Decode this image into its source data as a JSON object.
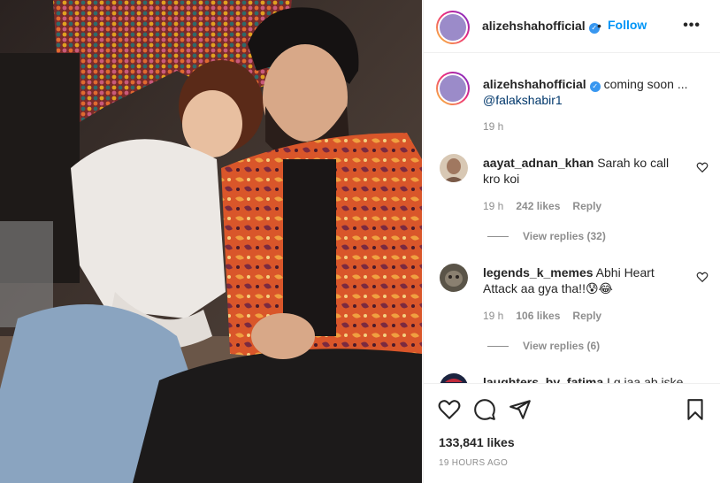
{
  "post": {
    "username": "alizehshahofficial",
    "follow_label": "Follow",
    "separator": "•",
    "more_label": "•••",
    "verified_mark": "✓",
    "caption": {
      "username": "alizehshahofficial",
      "text": "coming soon ...",
      "mention": "@falakshabir1",
      "time": "19 h"
    },
    "comments": [
      {
        "username": "aayat_adnan_khan",
        "text": "Sarah ko call kro koi",
        "time": "19 h",
        "likes": "242 likes",
        "reply_label": "Reply",
        "view_replies": "View replies (32)"
      },
      {
        "username": "legends_k_memes",
        "text": "Abhi Heart Attack aa gya tha!!😰😂",
        "time": "19 h",
        "likes": "106 likes",
        "reply_label": "Reply",
        "view_replies": "View replies (6)"
      },
      {
        "username": "laughters_by_fatima",
        "text": "Lg jaa ab iske"
      }
    ],
    "likes_count": "133,841 likes",
    "posted_ago": "19 HOURS AGO"
  },
  "icons": {
    "like": "heart-icon",
    "comment": "comment-icon",
    "share": "send-icon",
    "save": "bookmark-icon"
  },
  "colors": {
    "follow": "#0095f6",
    "verified": "#3897f0",
    "mention": "#00376b",
    "muted": "#8e8e8e"
  }
}
